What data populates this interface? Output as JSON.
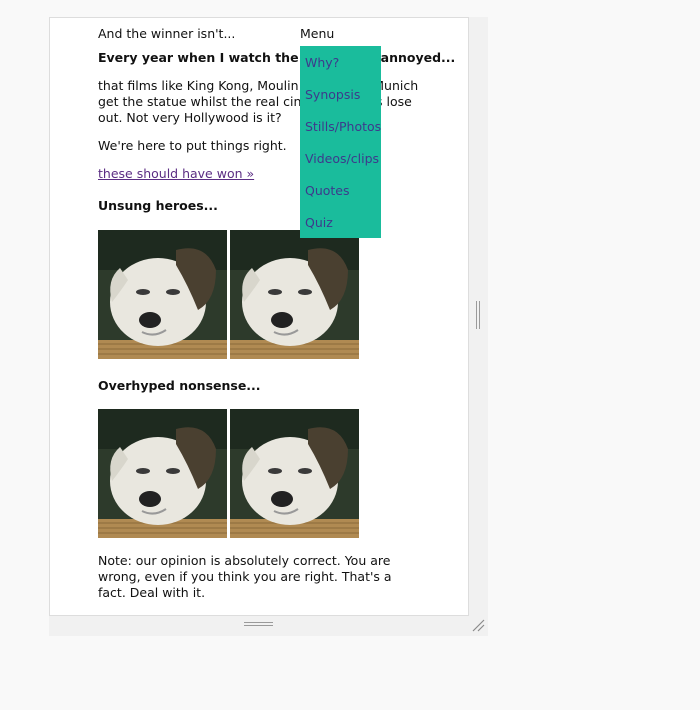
{
  "header": {
    "title": "And the winner isn't...",
    "menu_label": "Menu"
  },
  "menu": {
    "items": [
      "Why?",
      "Synopsis",
      "Stills/Photos",
      "Videos/clips",
      "Quotes",
      "Quiz"
    ]
  },
  "article": {
    "heading": "Every year when I watch the Oscars I'm annoyed...",
    "intro": "that films like King Kong, Moulin Rouge and Munich get the statue whilst the real cinematic gems lose out. Not very Hollywood is it?",
    "tagline": "We're here to put things right.",
    "link_text": "these should have won »",
    "section1_heading": "Unsung heroes...",
    "section2_heading": "Overhyped nonsense...",
    "note": "Note: our opinion is absolutely correct. You are wrong, even if you think you are right. That's a fact. Deal with it."
  },
  "images": {
    "subject": "puppy-photo",
    "count_per_row": 2
  },
  "colors": {
    "menu_bg": "#1abc9c",
    "menu_text": "#3d3a8c",
    "link": "#5b2d83"
  }
}
